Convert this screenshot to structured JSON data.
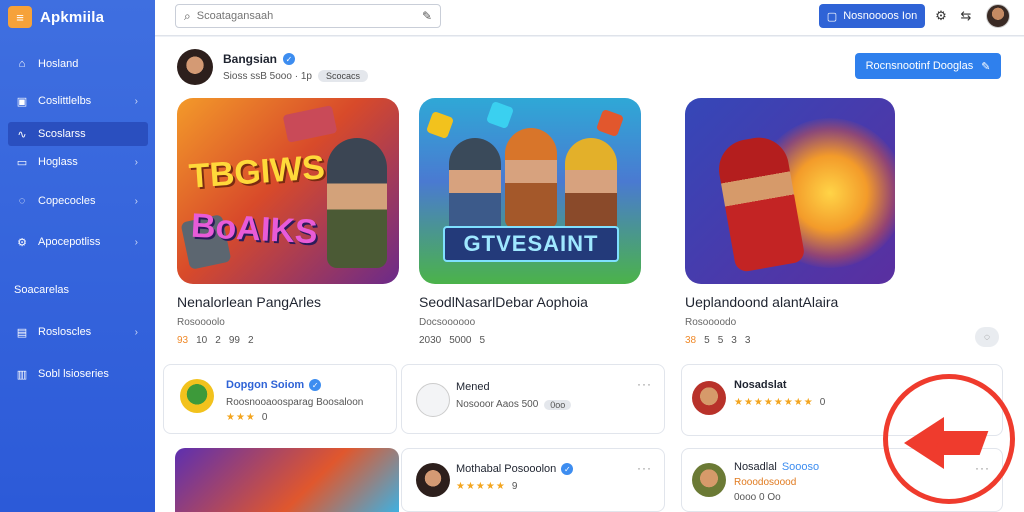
{
  "brand": {
    "logo_text": "≡",
    "name": "Apkmiila"
  },
  "sidebar": {
    "items": [
      {
        "label": "Hosland",
        "icon": "home-icon",
        "glyph": "⌂",
        "chevron": ""
      },
      {
        "label": "Coslittlelbs",
        "icon": "grid-icon",
        "glyph": "▣",
        "chevron": "›"
      },
      {
        "label": "Scoslarss",
        "icon": "waves-icon",
        "glyph": "∿",
        "chevron": ""
      },
      {
        "label": "Hoglass",
        "icon": "window-icon",
        "glyph": "▭",
        "chevron": "›"
      },
      {
        "label": "Copecocles",
        "icon": "chat-icon",
        "glyph": "◌",
        "chevron": "›"
      },
      {
        "label": "Apocepotliss",
        "icon": "gear-icon",
        "glyph": "⚙",
        "chevron": "›"
      }
    ],
    "section_label": "Soacarelas",
    "section_items": [
      {
        "label": "Rosloscles",
        "icon": "box-icon",
        "glyph": "▤",
        "chevron": "›"
      },
      {
        "label": "Sobl lsioseries",
        "icon": "doc-icon",
        "glyph": "▥",
        "chevron": ""
      }
    ]
  },
  "topbar": {
    "search_placeholder": "Scoatagansaah",
    "primary_button": "Nosnoooos Ion",
    "icons": [
      "settings-icon",
      "share-icon"
    ]
  },
  "profile": {
    "name": "Bangsian",
    "meta": "Sioss ssB 5ooo · 1p",
    "chip": "Scocacs"
  },
  "follow_button": "Rocnsnootinf Dooglas",
  "featured": [
    {
      "art_word_1": "TBGIWS",
      "art_word_2": "BoAIKS",
      "title": "Nenalorlean PangArles",
      "subtitle": "Rosoooolo",
      "stats": [
        "93",
        "10",
        "2",
        "99",
        "2"
      ]
    },
    {
      "art_word_1": "GTVESAINT",
      "title": "SeodlNasarlDebar Aophoia",
      "subtitle": "Docsoooooo",
      "stats": [
        "2030",
        "5000",
        "5"
      ]
    },
    {
      "title": "Ueplandoond alantAlaira",
      "subtitle": "Rosoooodo",
      "stats": [
        "38",
        "5",
        "5",
        "3",
        "3"
      ]
    }
  ],
  "cards": {
    "card1": {
      "title": "Dopgon Soiom",
      "sub": "Roosnooaoosparag Boosaloon",
      "stars": "★★★",
      "count": "0"
    },
    "card2": {
      "title": "Mened",
      "sub": "Nosooor Aaos 500",
      "chip": "0oo"
    },
    "card3": {
      "title": "Nosadslat",
      "stars": "★★★★★★★★",
      "count": "0"
    },
    "card4": {
      "title": "Mothabal Posooolon",
      "stars": "★★★★★",
      "count": "9"
    },
    "card5": {
      "title": "Nosadlal",
      "title_accent": "Soooso",
      "sub": "Rooodosoood",
      "meta": "0ooo 0 Oo"
    }
  },
  "colors": {
    "sidebar": "#2f5ed9",
    "accent": "#2f80ed",
    "highlight": "#ef3b2d"
  }
}
